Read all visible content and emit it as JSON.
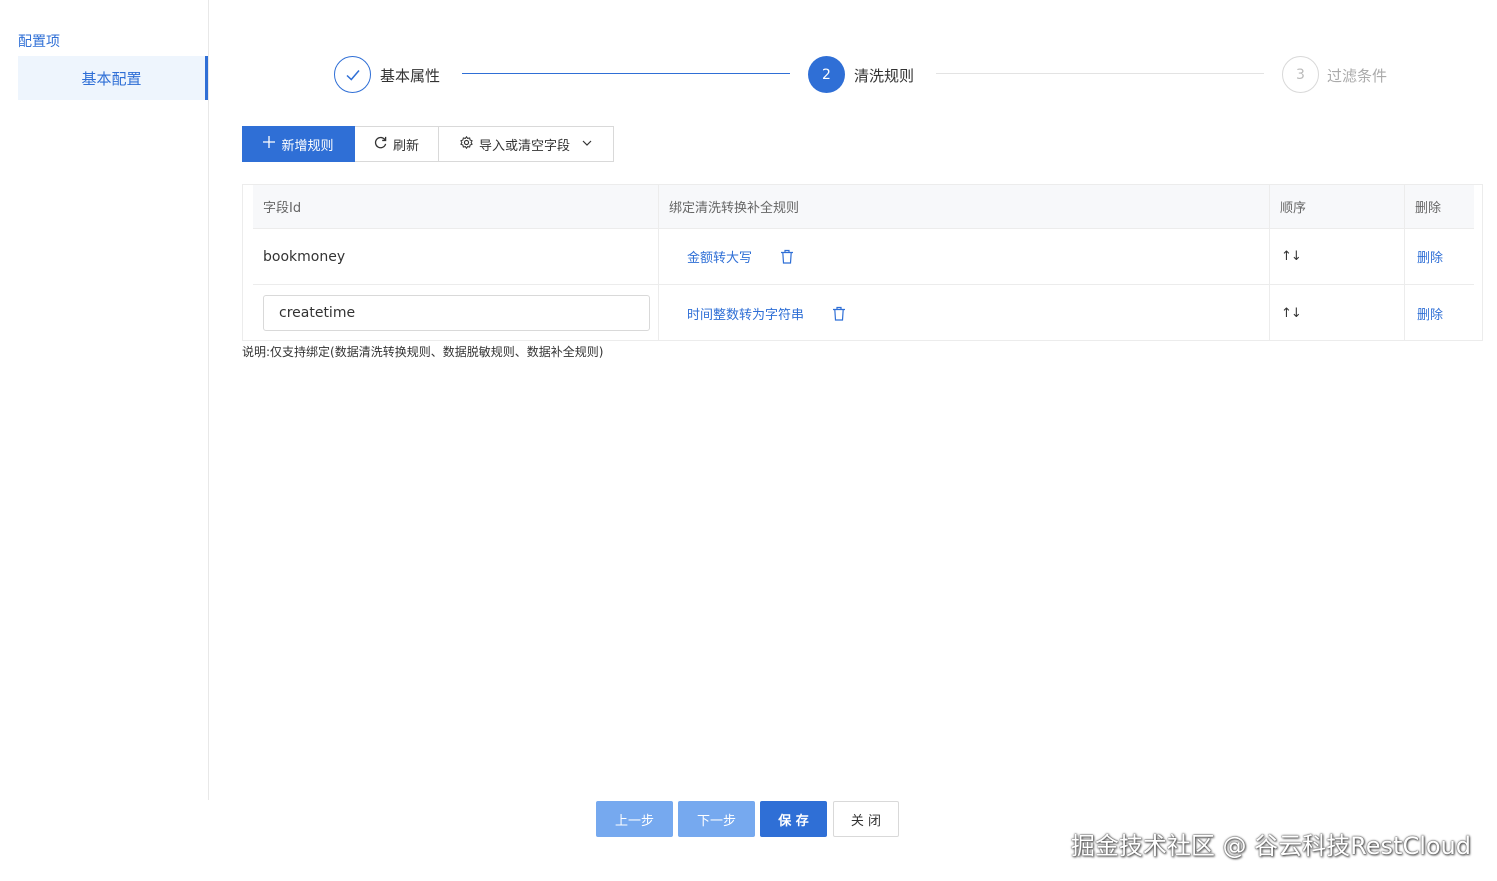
{
  "sidebar": {
    "title": "配置项",
    "items": [
      {
        "label": "基本配置"
      }
    ]
  },
  "steps": [
    {
      "label": "基本属性",
      "number": "1",
      "status": "finished"
    },
    {
      "label": "清洗规则",
      "number": "2",
      "status": "active"
    },
    {
      "label": "过滤条件",
      "number": "3",
      "status": "waiting"
    }
  ],
  "toolbar": {
    "add_rule": "新增规则",
    "refresh": "刷新",
    "import_clear": "导入或清空字段"
  },
  "table": {
    "headers": [
      "字段Id",
      "绑定清洗转换补全规则",
      "顺序",
      "删除"
    ],
    "rows": [
      {
        "field_id": "bookmoney",
        "rule": "金额转大写",
        "order": "↑↓",
        "delete": "删除"
      },
      {
        "field_id": "createtime",
        "rule": "时间整数转为字符串",
        "order": "↑↓",
        "delete": "删除"
      }
    ]
  },
  "note": "说明:仅支持绑定(数据清洗转换规则、数据脱敏规则、数据补全规则)",
  "footer": {
    "prev": "上一步",
    "next": "下一步",
    "save": "保 存",
    "close": "关 闭"
  },
  "watermark": "掘金技术社区 @ 谷云科技RestCloud",
  "colors": {
    "primary": "#2f6fd6",
    "primary_light": "#76a9ef"
  }
}
